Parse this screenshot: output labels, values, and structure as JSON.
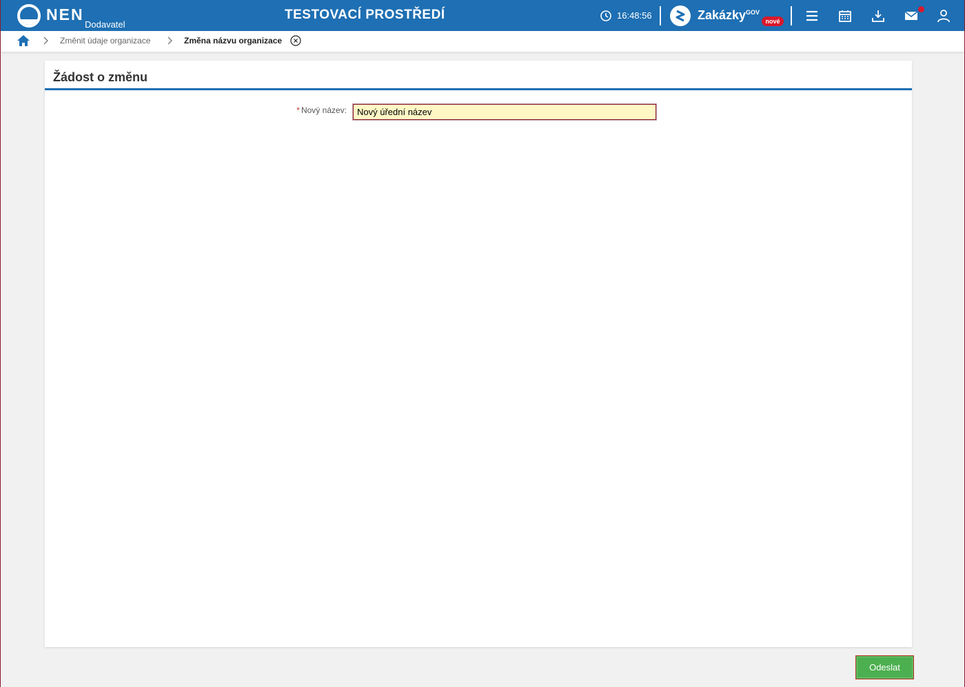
{
  "header": {
    "logo_text": "NEN",
    "logo_subtitle": "Dodavatel",
    "environment_title": "TESTOVACÍ PROSTŘEDÍ",
    "clock_time": "16:48:56",
    "zakazky_label": "Zakázky",
    "zakazky_gov": "GOV",
    "zakazky_badge": "nové",
    "icons": [
      "clock-icon",
      "zakazky-logo-icon",
      "menu-icon",
      "calendar-icon",
      "download-icon",
      "mail-icon",
      "user-icon"
    ],
    "colors": {
      "bar": "#1e6fb3",
      "badge": "#d8192b"
    }
  },
  "breadcrumb": {
    "items": [
      {
        "label": "Změnit údaje organizace"
      },
      {
        "label": "Změna názvu organizace"
      }
    ]
  },
  "form": {
    "title": "Žádost o změnu",
    "field_label": "Nový název:",
    "required_mark": "*",
    "field_value": "Nový úřední název",
    "submit_label": "Odeslat",
    "colors": {
      "input_bg": "#fff8c5",
      "submit_bg": "#4caf50",
      "accent": "#1e6fb3"
    }
  }
}
